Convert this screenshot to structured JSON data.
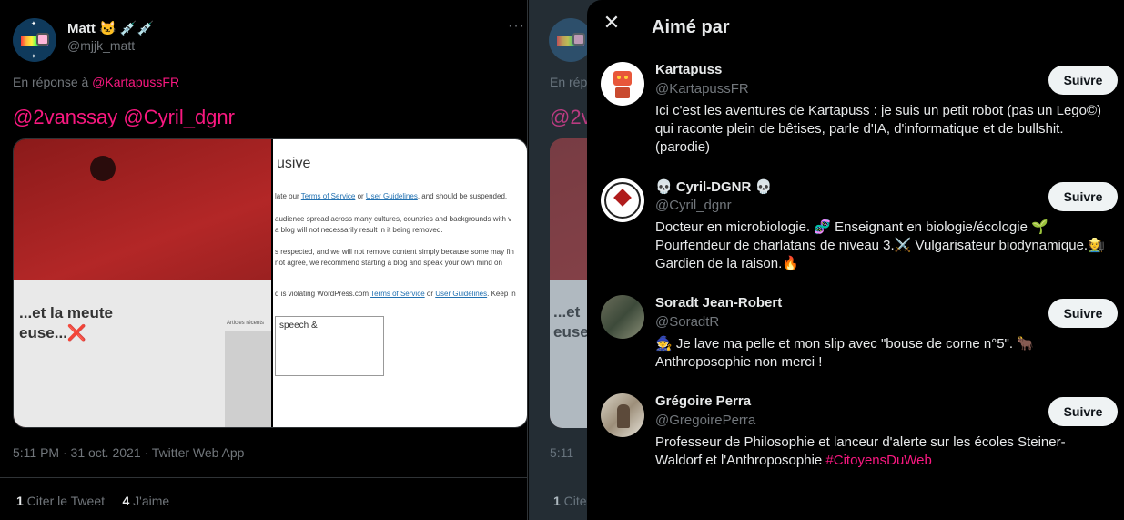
{
  "tweet": {
    "author_name": "Matt 🐱 💉💉",
    "author_handle": "@mjjk_matt",
    "more_icon": "more-horizontal-icon",
    "reply_prefix": "En réponse à ",
    "reply_mention": "@KartapussFR",
    "mentions": "@2vanssay @Cyril_dgnr",
    "media": {
      "left_headline_line1": "...et la meute",
      "left_headline_line2": "euse...❌",
      "left_side_label": "Articles récents",
      "right_title": "usive",
      "right_p1_a": "late our ",
      "right_p1_link1": "Terms of Service",
      "right_p1_b": " or ",
      "right_p1_link2": "User Guidelines",
      "right_p1_c": ", and should be suspended.",
      "right_p2": "audience spread across many cultures, countries and backgrounds with v",
      "right_p3": "a blog will not necessarily result in it being removed.",
      "right_p4": "s respected, and we will not remove content simply because some may fin",
      "right_p5": "not agree, we recommend starting a blog and speak your own mind on",
      "right_p6_a": "d is violating WordPress.com ",
      "right_p6_link1": "Terms of Service",
      "right_p6_b": " or ",
      "right_p6_link2": "User Guidelines",
      "right_p6_c": ". Keep in",
      "textarea_text": "speech &"
    },
    "timestamp": "5:11 PM · 31 oct. 2021 · Twitter Web App",
    "quote_count": "1",
    "quote_label": " Citer le Tweet",
    "like_count": "4",
    "like_label": " J'aime"
  },
  "background_tweet": {
    "reply_fragment": "En rép",
    "mention_fragment": "@2v",
    "headline_line1": "...et",
    "headline_line2": "euse.",
    "timestamp_fragment": "5:11",
    "stats_count": "1",
    "stats_label": " Cite"
  },
  "modal": {
    "title": "Aimé par",
    "close_icon": "close-icon",
    "follow_label": "Suivre",
    "users": [
      {
        "name": "Kartapuss",
        "handle": "@KartapussFR",
        "bio": "Ici c'est les aventures de Kartapuss : je suis un petit robot (pas un Lego©) qui raconte plein de bêtises, parle d'IA, d'informatique et de bullshit. (parodie)"
      },
      {
        "name": "💀 Cyril-DGNR 💀",
        "handle": "@Cyril_dgnr",
        "bio": "Docteur en microbiologie. 🧬 Enseignant en biologie/écologie 🌱 Pourfendeur de charlatans de niveau 3.⚔️ Vulgarisateur biodynamique.🧑‍🌾 Gardien de la raison.🔥"
      },
      {
        "name": "Soradt Jean-Robert",
        "handle": "@SoradtR",
        "bio": "🧙 Je lave ma pelle et mon slip avec \"bouse de corne n°5\". 🐂 Anthroposophie non merci !"
      },
      {
        "name": "Grégoire Perra",
        "handle": "@GregoirePerra",
        "bio_text": "Professeur de Philosophie et lanceur d'alerte sur les écoles Steiner-Waldorf et l'Anthroposophie ",
        "bio_tag": "#CitoyensDuWeb"
      }
    ]
  }
}
